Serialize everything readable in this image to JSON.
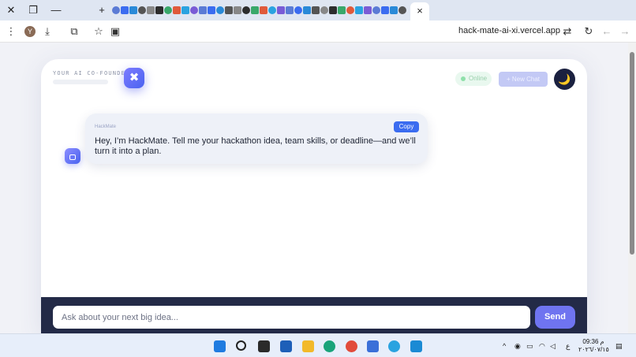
{
  "browser": {
    "window_controls": [
      "close-icon",
      "restore-icon",
      "minimize-icon"
    ],
    "new_tab_glyph": "+",
    "active_tab_close_glyph": "×",
    "url": "hack-mate-ai-xi.vercel.app",
    "profile_initial": "Y",
    "toolbar_icons": [
      "menu-icon",
      "download-icon",
      "extensions-icon",
      "star-icon",
      "translate-icon",
      "tune-icon",
      "reload-icon",
      "back-icon",
      "forward-icon"
    ]
  },
  "app": {
    "eyebrow": "YOUR AI CO-FOUNDER",
    "logo_glyph": "✖",
    "status": "Online",
    "new_chat_label": "+ New Chat",
    "theme_glyph": "🌙",
    "message": {
      "author": "HackMate",
      "text": "Hey, I’m HackMate. Tell me your hackathon idea, team skills, or deadline—and we’ll turn it into a plan.",
      "copy_label": "Copy"
    },
    "composer": {
      "placeholder": "Ask about your next big idea...",
      "send_label": "Send"
    },
    "colors": {
      "accent": "#6f74f0",
      "copy": "#3b6cf0",
      "composer_bg": "#232a47",
      "online": "#8fe0aa"
    }
  },
  "taskbar": {
    "apps": [
      "windows-start-icon",
      "search-icon",
      "task-view-icon",
      "widgets-icon",
      "file-explorer-icon",
      "edge-icon",
      "chrome-icon",
      "store-icon",
      "telegram-icon",
      "vscode-icon"
    ],
    "tray_chevron": "^",
    "language": "ع",
    "time": "09:36 م",
    "date": "٢٠٢٦/٠٧/١٥"
  }
}
